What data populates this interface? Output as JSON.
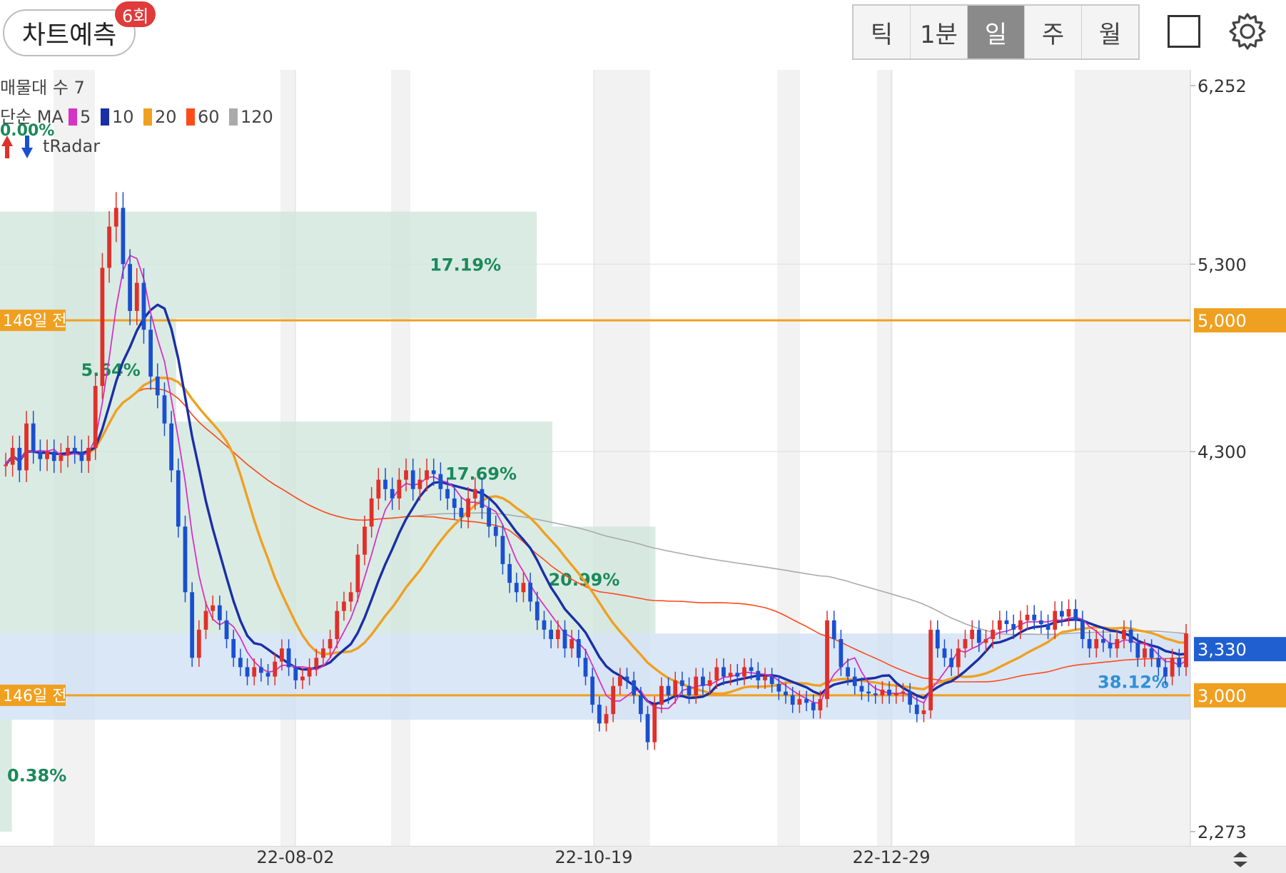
{
  "header": {
    "predict_label": "차트예측",
    "predict_badge": "6회",
    "periods": [
      {
        "label": "틱",
        "active": false
      },
      {
        "label": "1분",
        "active": false
      },
      {
        "label": "일",
        "active": true
      },
      {
        "label": "주",
        "active": false
      },
      {
        "label": "월",
        "active": false
      }
    ],
    "square_icon": "square-icon",
    "settings_icon": "gear-icon"
  },
  "legend": {
    "line1": "매물대 수 7",
    "ma_prefix": "단순 MA",
    "ma": [
      {
        "period": "5",
        "color": "#d633c4"
      },
      {
        "period": "10",
        "color": "#1a2fa6"
      },
      {
        "period": "20",
        "color": "#f0a020"
      },
      {
        "period": "60",
        "color": "#ff4a1a"
      },
      {
        "period": "120",
        "color": "#aaaaaa"
      }
    ],
    "radar_label": "tRadar",
    "top_pct": "0.00%"
  },
  "colors": {
    "up": "#e0302a",
    "down": "#1a4fcf",
    "vp_green": "#cfe6dc",
    "vp_blue": "#cfe0f5",
    "pct_text": "#1a8a5a",
    "orange_line": "#f0a020",
    "current_price_bg": "#1f5fd0"
  },
  "chart_data": {
    "type": "candlestick",
    "y_axis": {
      "min": 2273,
      "max": 6252,
      "ticks": [
        "6,252",
        "5,300",
        "4,300",
        "2,273"
      ]
    },
    "x_labels": [
      "22-08-02",
      "22-10-19",
      "22-12-29"
    ],
    "horizontal_lines": [
      {
        "value": 5000,
        "left_label": "146일 전",
        "right_label": "5,000"
      },
      {
        "value": 3000,
        "left_label": "146일 전",
        "right_label": "3,000"
      }
    ],
    "current_price": {
      "value": 3330,
      "label": "3,330"
    },
    "volume_profile": [
      {
        "low": 5010,
        "high": 5580,
        "pct": "17.19%"
      },
      {
        "low": 4460,
        "high": 5010,
        "pct": "5.64%"
      },
      {
        "low": 3900,
        "high": 4460,
        "pct": "17.69%"
      },
      {
        "low": 3330,
        "high": 3900,
        "pct": "20.99%"
      },
      {
        "low": 2870,
        "high": 3330,
        "pct": "38.12%"
      },
      {
        "low": 2273,
        "high": 2870,
        "pct": "0.38%"
      }
    ],
    "closes": [
      4230,
      4320,
      4200,
      4450,
      4300,
      4260,
      4300,
      4250,
      4280,
      4320,
      4300,
      4250,
      4320,
      4650,
      5280,
      5500,
      5600,
      5300,
      5050,
      5200,
      4950,
      4700,
      4600,
      4450,
      4200,
      3900,
      3550,
      3200,
      3350,
      3450,
      3480,
      3400,
      3300,
      3200,
      3150,
      3100,
      3150,
      3120,
      3100,
      3180,
      3250,
      3150,
      3080,
      3100,
      3150,
      3200,
      3250,
      3300,
      3450,
      3500,
      3550,
      3750,
      3900,
      4050,
      4150,
      4100,
      4050,
      4150,
      4200,
      4100,
      4150,
      4200,
      4180,
      4100,
      4050,
      4000,
      3950,
      4050,
      4100,
      4000,
      3900,
      3850,
      3700,
      3600,
      3550,
      3600,
      3500,
      3400,
      3350,
      3300,
      3350,
      3250,
      3300,
      3200,
      3100,
      2950,
      2850,
      2900,
      3050,
      3100,
      3080,
      3000,
      2900,
      2750,
      2950,
      3050,
      3000,
      3080,
      3050,
      3000,
      3100,
      3050,
      3080,
      3150,
      3100,
      3120,
      3100,
      3150,
      3130,
      3080,
      3100,
      3060,
      3020,
      3000,
      2950,
      2980,
      2960,
      2920,
      2980,
      3400,
      3300,
      3150,
      3100,
      3050,
      3020,
      3010,
      3000,
      3030,
      3000,
      3010,
      3020,
      2950,
      2900,
      2920,
      3350,
      3250,
      3200,
      3150,
      3250,
      3300,
      3350,
      3280,
      3300,
      3350,
      3400,
      3380,
      3350,
      3400,
      3430,
      3400,
      3380,
      3350,
      3450,
      3420,
      3460,
      3400,
      3300,
      3250,
      3300,
      3280,
      3250,
      3300,
      3350,
      3280,
      3200,
      3250,
      3200,
      3150,
      3100,
      3200,
      3150,
      3330
    ]
  }
}
